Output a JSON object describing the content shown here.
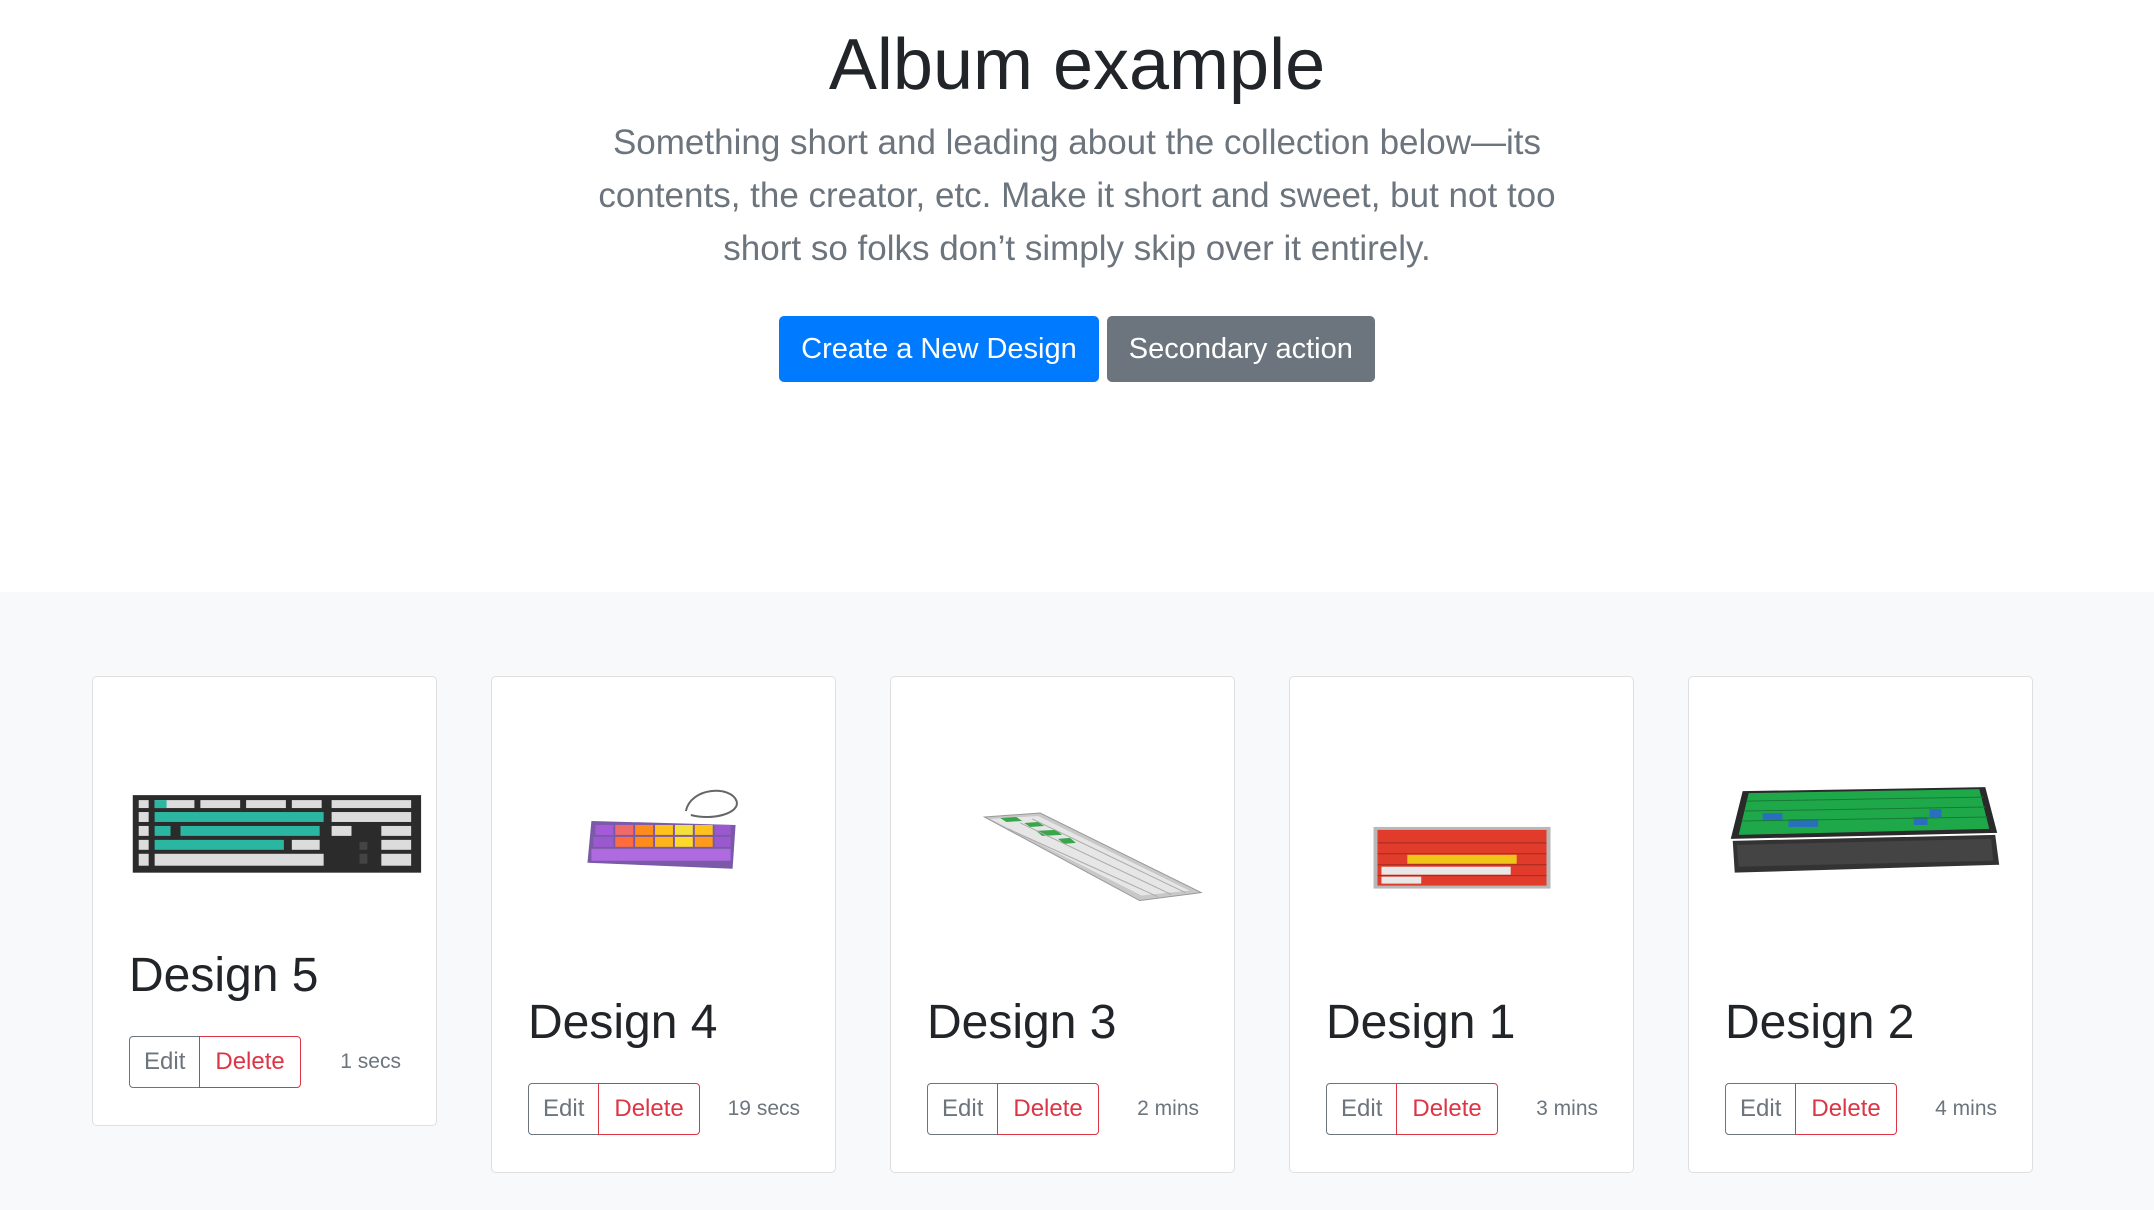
{
  "hero": {
    "title": "Album example",
    "lead": "Something short and leading about the collection below—its contents, the creator, etc. Make it short and sweet, but not too short so folks don’t simply skip over it entirely.",
    "primary_label": "Create a New Design",
    "secondary_label": "Secondary action"
  },
  "colors": {
    "primary": "#007bff",
    "secondary": "#6c757d",
    "danger": "#dc3545",
    "album_bg": "#f8f9fa"
  },
  "cards": [
    {
      "title": "Design 5",
      "edit_label": "Edit",
      "delete_label": "Delete",
      "time": "1 secs"
    },
    {
      "title": "Design 4",
      "edit_label": "Edit",
      "delete_label": "Delete",
      "time": "19 secs"
    },
    {
      "title": "Design 3",
      "edit_label": "Edit",
      "delete_label": "Delete",
      "time": "2 mins"
    },
    {
      "title": "Design 1",
      "edit_label": "Edit",
      "delete_label": "Delete",
      "time": "3 mins"
    },
    {
      "title": "Design 2",
      "edit_label": "Edit",
      "delete_label": "Delete",
      "time": "4 mins"
    }
  ]
}
